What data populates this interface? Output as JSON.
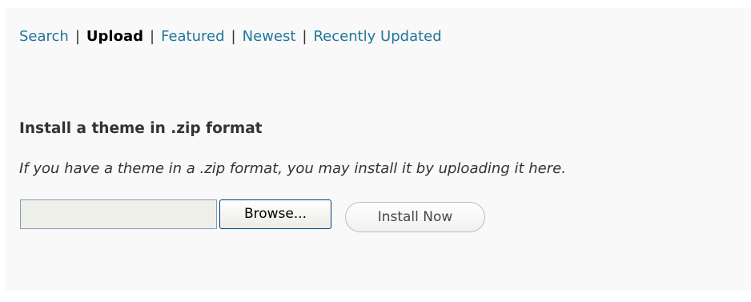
{
  "subnav": {
    "items": [
      {
        "label": "Search",
        "current": false
      },
      {
        "label": "Upload",
        "current": true
      },
      {
        "label": "Featured",
        "current": false
      },
      {
        "label": "Newest",
        "current": false
      },
      {
        "label": "Recently Updated",
        "current": false
      }
    ],
    "separator": "|"
  },
  "upload": {
    "heading": "Install a theme in .zip format",
    "description": "If you have a theme in a .zip format, you may install it by uploading it here.",
    "file_value": "",
    "browse_label": "Browse...",
    "install_label": "Install Now"
  },
  "colors": {
    "link": "#21759b",
    "panel_background": "#f9f9f9",
    "text": "#333333"
  }
}
